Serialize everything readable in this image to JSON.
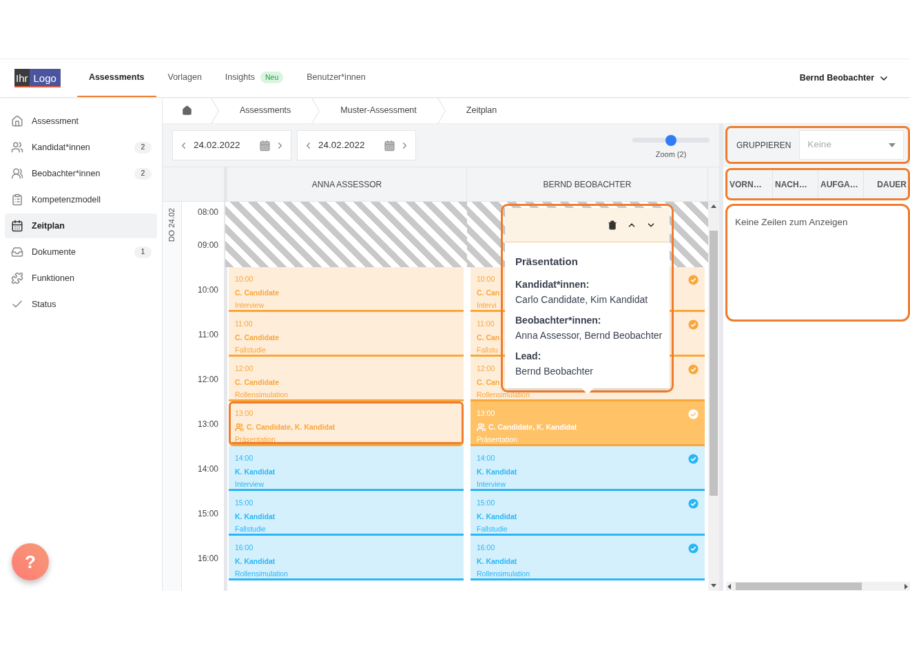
{
  "header": {
    "logo": {
      "part_1": "Ihr",
      "part_2": "Logo"
    },
    "nav": [
      {
        "label": "Assessments",
        "selected": true
      },
      {
        "label": "Vorlagen",
        "selected": false
      },
      {
        "label": "Insights",
        "selected": false,
        "badge": "Neu"
      },
      {
        "label": "Benutzer*innen",
        "selected": false
      }
    ],
    "user": "Bernd Beobachter"
  },
  "sidebar": {
    "items": [
      {
        "label": "Assessment",
        "selected": false
      },
      {
        "label": "Kandidat*innen",
        "selected": false,
        "count": "2"
      },
      {
        "label": "Beobachter*innen",
        "selected": false,
        "count": "2"
      },
      {
        "label": "Kompetenzmodell",
        "selected": false
      },
      {
        "label": "Zeitplan",
        "selected": true
      },
      {
        "label": "Dokumente",
        "selected": false,
        "count": "1"
      },
      {
        "label": "Funktionen",
        "selected": false
      },
      {
        "label": "Status",
        "selected": false
      }
    ]
  },
  "breadcrumb": [
    "Assessments",
    "Muster-Assessment",
    "Zeitplan"
  ],
  "toolbar": {
    "date_pickers": [
      {
        "value": "24.02.2022"
      },
      {
        "value": "24.02.2022"
      }
    ],
    "zoom": {
      "level": 0.5,
      "label": "Zoom (2)"
    }
  },
  "schedule": {
    "day_label": "DO 24.02",
    "hours": [
      "08:00",
      "09:00",
      "10:00",
      "11:00",
      "12:00",
      "13:00",
      "14:00",
      "15:00",
      "16:00"
    ],
    "columns": [
      {
        "name": "ANNA ASSESSOR",
        "events": [
          {
            "time": "10:00",
            "title": "C. Candidate",
            "subtitle": "Interview",
            "color": "#f9a63a",
            "selected": false,
            "confirmed": false,
            "group": false,
            "highlighted": false
          },
          {
            "time": "11:00",
            "title": "C. Candidate",
            "subtitle": "Fallstudie",
            "color": "#f9a63a",
            "selected": false,
            "confirmed": false,
            "group": false,
            "highlighted": false
          },
          {
            "time": "12:00",
            "title": "C. Candidate",
            "subtitle": "Rollensimulation",
            "color": "#f9a63a",
            "selected": false,
            "confirmed": false,
            "group": false,
            "highlighted": false
          },
          {
            "time": "13:00",
            "title": "C. Candidate, K. Kandidat",
            "subtitle": "Präsentation",
            "color": "#f9a63a",
            "selected": false,
            "confirmed": false,
            "group": true,
            "highlighted": true
          },
          {
            "time": "14:00",
            "title": "K. Kandidat",
            "subtitle": "Interview",
            "color": "#29b6f6",
            "selected": false,
            "confirmed": false,
            "group": false,
            "highlighted": false
          },
          {
            "time": "15:00",
            "title": "K. Kandidat",
            "subtitle": "Fallstudie",
            "color": "#29b6f6",
            "selected": false,
            "confirmed": false,
            "group": false,
            "highlighted": false
          },
          {
            "time": "16:00",
            "title": "K. Kandidat",
            "subtitle": "Rollensimulation",
            "color": "#29b6f6",
            "selected": false,
            "confirmed": false,
            "group": false,
            "highlighted": false
          }
        ]
      },
      {
        "name": "BERND BEOBACHTER",
        "events": [
          {
            "time": "10:00",
            "title": "C. Can",
            "subtitle": "Intervi",
            "color": "#f9a63a",
            "selected": false,
            "confirmed": true,
            "group": false,
            "highlighted": false
          },
          {
            "time": "11:00",
            "title": "C. Can",
            "subtitle": "Fallstu",
            "color": "#f9a63a",
            "selected": false,
            "confirmed": true,
            "group": false,
            "highlighted": false
          },
          {
            "time": "12:00",
            "title": "C. Can",
            "subtitle": "Rollensimulation",
            "color": "#f9a63a",
            "selected": false,
            "confirmed": true,
            "group": false,
            "highlighted": false
          },
          {
            "time": "13:00",
            "title": "C. Candidate, K. Kandidat",
            "subtitle": "Präsentation",
            "color": "#f9a63a",
            "selected": true,
            "confirmed": true,
            "group": true,
            "highlighted": false
          },
          {
            "time": "14:00",
            "title": "K. Kandidat",
            "subtitle": "Interview",
            "color": "#29b6f6",
            "selected": false,
            "confirmed": true,
            "group": false,
            "highlighted": false
          },
          {
            "time": "15:00",
            "title": "K. Kandidat",
            "subtitle": "Fallstudie",
            "color": "#29b6f6",
            "selected": false,
            "confirmed": true,
            "group": false,
            "highlighted": false
          },
          {
            "time": "16:00",
            "title": "K. Kandidat",
            "subtitle": "Rollensimulation",
            "color": "#29b6f6",
            "selected": false,
            "confirmed": true,
            "group": false,
            "highlighted": false
          }
        ]
      }
    ]
  },
  "popover": {
    "highlighted": true,
    "title": "Präsentation",
    "sections": [
      {
        "label": "Kandidat*innen:",
        "value": "Carlo Candidate, Kim Kandidat"
      },
      {
        "label": "Beobachter*innen:",
        "value": "Anna Assessor, Bernd Beobachter"
      },
      {
        "label": "Lead:",
        "value": "Bernd Beobachter"
      }
    ]
  },
  "grouping": {
    "highlighted": true,
    "label": "GRUPPIEREN",
    "placeholder": "Keine"
  },
  "table": {
    "highlighted": true,
    "columns": [
      "VORN…",
      "NACH…",
      "AUFGA…",
      "DAUER"
    ],
    "empty_message": "Keine Zeilen zum Anzeigen"
  },
  "help_button": {
    "label": "?"
  }
}
